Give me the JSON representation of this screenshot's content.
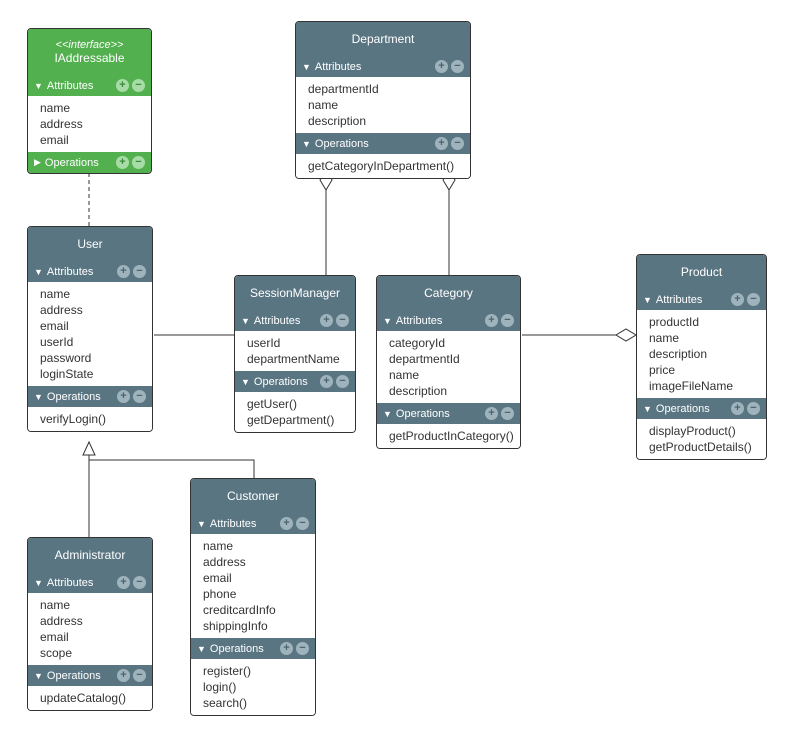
{
  "labels": {
    "attributes": "Attributes",
    "operations": "Operations"
  },
  "classes": {
    "iaddressable": {
      "stereotype": "<<interface>>",
      "name": "IAddressable",
      "attributes": [
        "name",
        "address",
        "email"
      ],
      "operations": []
    },
    "department": {
      "name": "Department",
      "attributes": [
        "departmentId",
        "name",
        "description"
      ],
      "operations": [
        "getCategoryInDepartment()"
      ]
    },
    "user": {
      "name": "User",
      "attributes": [
        "name",
        "address",
        "email",
        "userId",
        "password",
        "loginState"
      ],
      "operations": [
        "verifyLogin()"
      ]
    },
    "sessionmanager": {
      "name": "SessionManager",
      "attributes": [
        "userId",
        "departmentName"
      ],
      "operations": [
        "getUser()",
        "getDepartment()"
      ]
    },
    "category": {
      "name": "Category",
      "attributes": [
        "categoryId",
        "departmentId",
        "name",
        "description"
      ],
      "operations": [
        "getProductInCategory()"
      ]
    },
    "product": {
      "name": "Product",
      "attributes": [
        "productId",
        "name",
        "description",
        "price",
        "imageFileName"
      ],
      "operations": [
        "displayProduct()",
        "getProductDetails()"
      ]
    },
    "administrator": {
      "name": "Administrator",
      "attributes": [
        "name",
        "address",
        "email",
        "scope"
      ],
      "operations": [
        "updateCatalog()"
      ]
    },
    "customer": {
      "name": "Customer",
      "attributes": [
        "name",
        "address",
        "email",
        "phone",
        "creditcardInfo",
        "shippingInfo"
      ],
      "operations": [
        "register()",
        "login()",
        "search()"
      ]
    }
  },
  "chart_data": {
    "type": "table",
    "description": "UML class diagram",
    "classes": [
      {
        "name": "IAddressable",
        "kind": "interface",
        "attributes": [
          "name",
          "address",
          "email"
        ],
        "operations": []
      },
      {
        "name": "Department",
        "kind": "class",
        "attributes": [
          "departmentId",
          "name",
          "description"
        ],
        "operations": [
          "getCategoryInDepartment()"
        ]
      },
      {
        "name": "User",
        "kind": "class",
        "attributes": [
          "name",
          "address",
          "email",
          "userId",
          "password",
          "loginState"
        ],
        "operations": [
          "verifyLogin()"
        ]
      },
      {
        "name": "SessionManager",
        "kind": "class",
        "attributes": [
          "userId",
          "departmentName"
        ],
        "operations": [
          "getUser()",
          "getDepartment()"
        ]
      },
      {
        "name": "Category",
        "kind": "class",
        "attributes": [
          "categoryId",
          "departmentId",
          "name",
          "description"
        ],
        "operations": [
          "getProductInCategory()"
        ]
      },
      {
        "name": "Product",
        "kind": "class",
        "attributes": [
          "productId",
          "name",
          "description",
          "price",
          "imageFileName"
        ],
        "operations": [
          "displayProduct()",
          "getProductDetails()"
        ]
      },
      {
        "name": "Administrator",
        "kind": "class",
        "attributes": [
          "name",
          "address",
          "email",
          "scope"
        ],
        "operations": [
          "updateCatalog()"
        ]
      },
      {
        "name": "Customer",
        "kind": "class",
        "attributes": [
          "name",
          "address",
          "email",
          "phone",
          "creditcardInfo",
          "shippingInfo"
        ],
        "operations": [
          "register()",
          "login()",
          "search()"
        ]
      }
    ],
    "relationships": [
      {
        "from": "User",
        "to": "IAddressable",
        "type": "realization"
      },
      {
        "from": "Administrator",
        "to": "User",
        "type": "generalization"
      },
      {
        "from": "Customer",
        "to": "User",
        "type": "generalization"
      },
      {
        "from": "SessionManager",
        "to": "User",
        "type": "association"
      },
      {
        "from": "SessionManager",
        "to": "Department",
        "type": "aggregation"
      },
      {
        "from": "Department",
        "to": "Category",
        "type": "aggregation"
      },
      {
        "from": "Category",
        "to": "Product",
        "type": "aggregation"
      }
    ]
  }
}
